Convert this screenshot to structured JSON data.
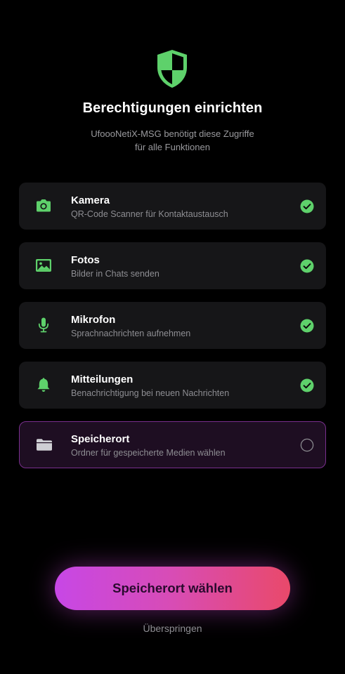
{
  "header": {
    "title": "Berechtigungen einrichten",
    "subtitle_line1": "UfoooNetiX-MSG benötigt diese Zugriffe",
    "subtitle_line2": "für alle Funktionen"
  },
  "permissions": [
    {
      "name": "Kamera",
      "description": "QR-Code Scanner für Kontaktaustausch",
      "icon": "camera-icon",
      "granted": true
    },
    {
      "name": "Fotos",
      "description": "Bilder in Chats senden",
      "icon": "photo-icon",
      "granted": true
    },
    {
      "name": "Mikrofon",
      "description": "Sprachnachrichten aufnehmen",
      "icon": "microphone-icon",
      "granted": true
    },
    {
      "name": "Mitteilungen",
      "description": "Benachrichtigung bei neuen Nachrichten",
      "icon": "bell-icon",
      "granted": true
    },
    {
      "name": "Speicherort",
      "description": "Ordner für gespeicherte Medien wählen",
      "icon": "folder-icon",
      "granted": false
    }
  ],
  "actions": {
    "primary_label": "Speicherort wählen",
    "skip_label": "Überspringen"
  },
  "colors": {
    "accent_green": "#5ed16b",
    "gradient_start": "#c747e6",
    "gradient_end": "#e9496a",
    "card_background": "#161618",
    "active_border": "#7a2f8e"
  }
}
